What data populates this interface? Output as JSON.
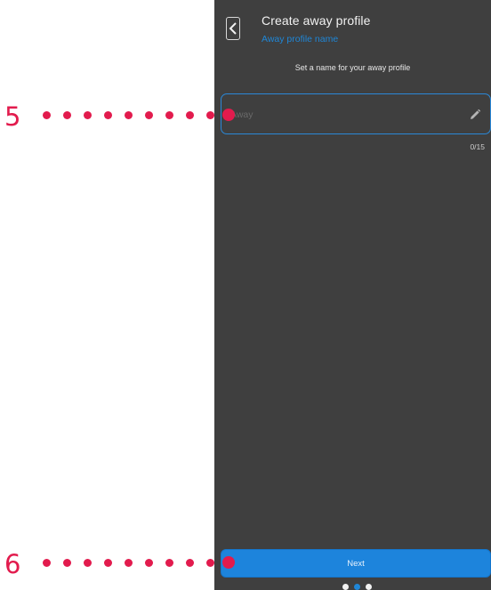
{
  "header": {
    "title": "Create away profile",
    "subtitle": "Away profile name"
  },
  "form": {
    "instruction": "Set a name for your away profile",
    "name_value": "",
    "name_placeholder": "Away",
    "counter": "0/15"
  },
  "footer": {
    "next_label": "Next",
    "pager_total": 3,
    "pager_active": 2
  },
  "annotations": [
    {
      "number": "5"
    },
    {
      "number": "6"
    }
  ],
  "colors": {
    "accent": "#1f86d6",
    "background": "#3f3f3f",
    "annotation": "#e21b4d"
  },
  "icons": [
    "chevron-left-icon",
    "pencil-icon"
  ]
}
